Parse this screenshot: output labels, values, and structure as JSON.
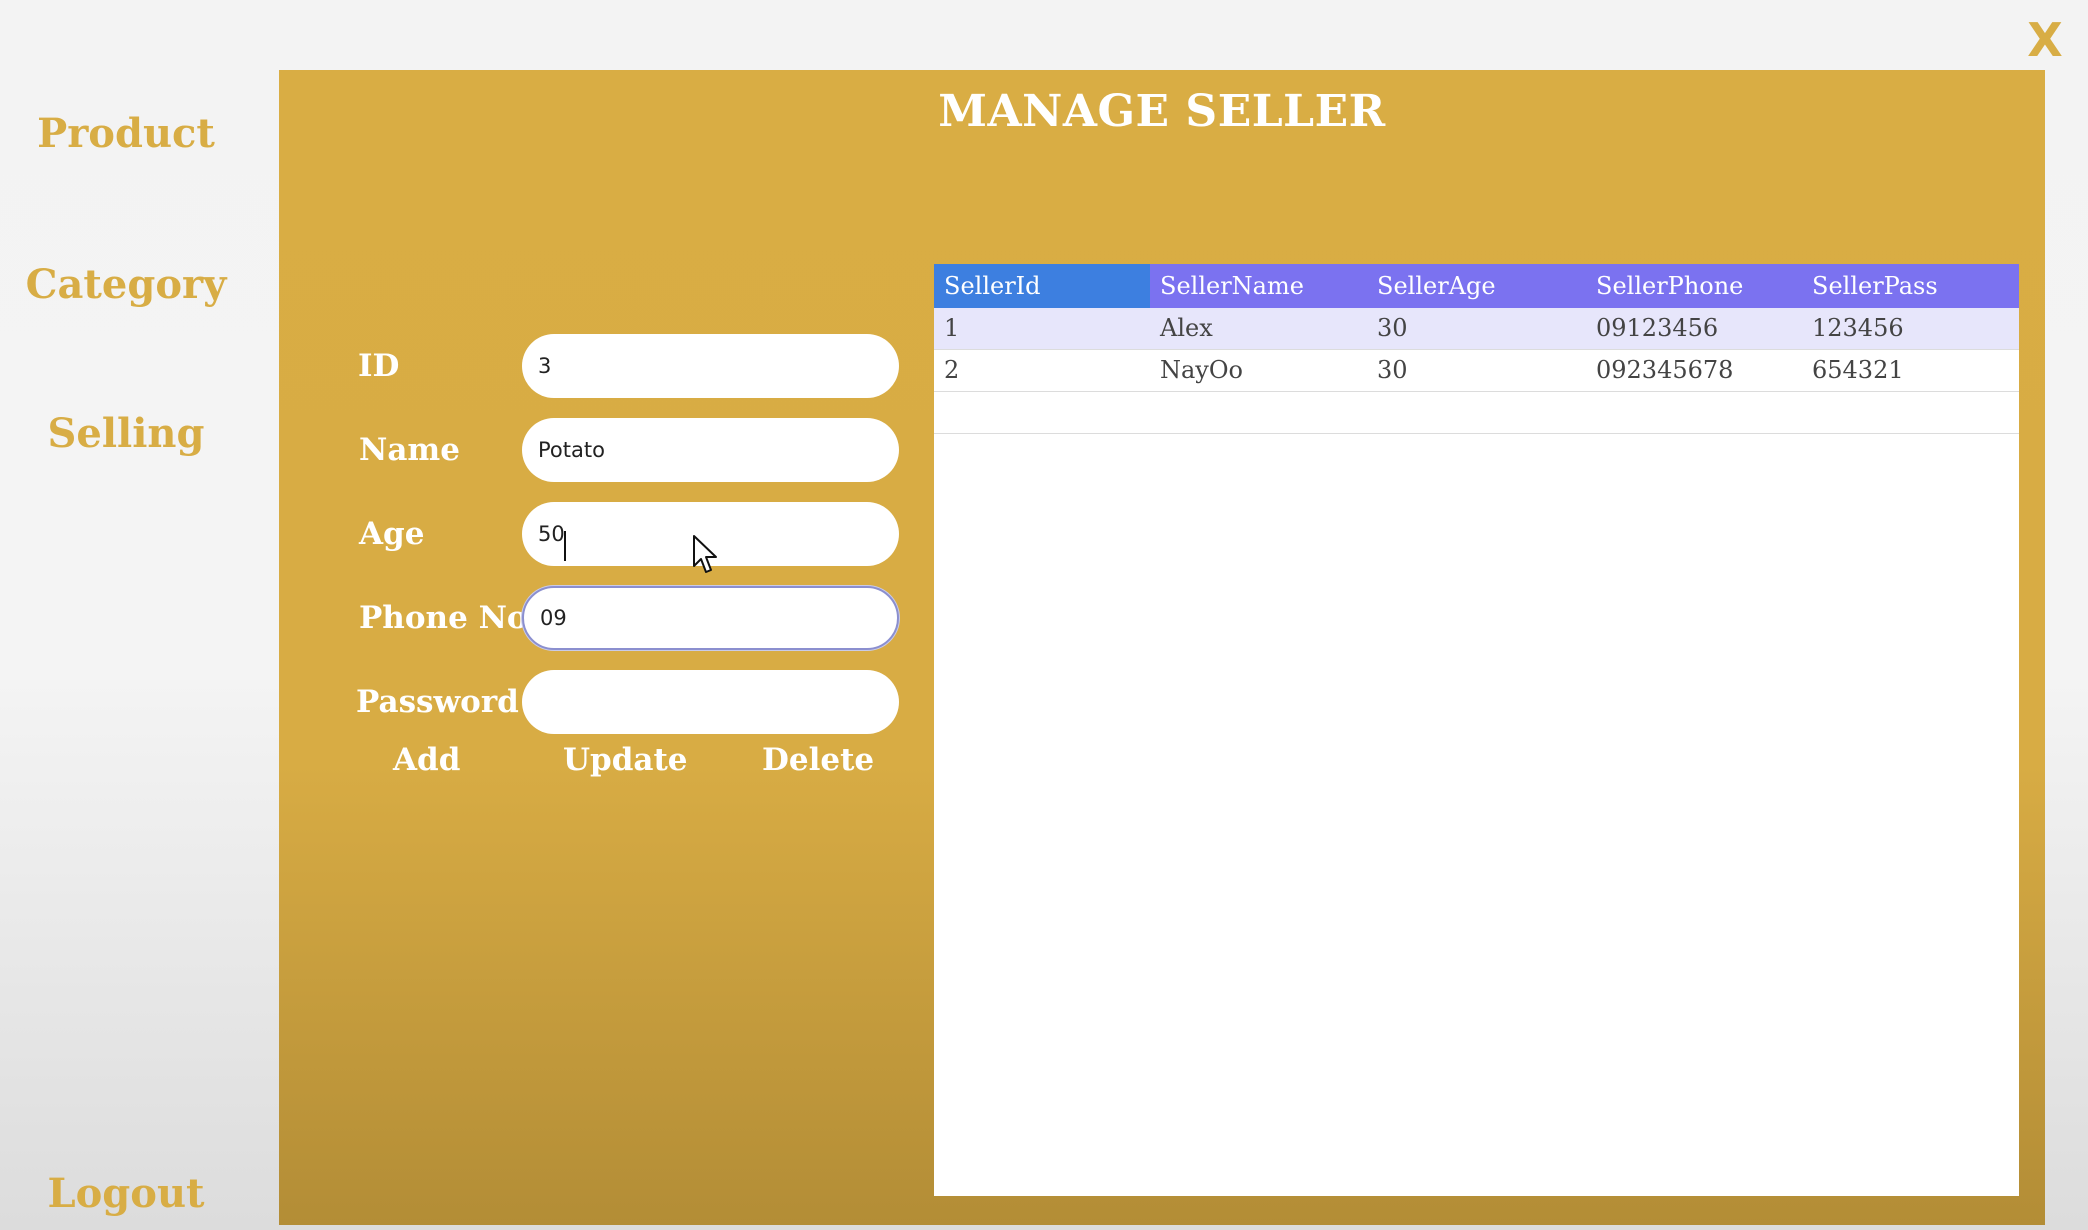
{
  "sidebar": {
    "items": [
      {
        "label": "Product"
      },
      {
        "label": "Category"
      },
      {
        "label": "Selling"
      }
    ],
    "logout": "Logout"
  },
  "window": {
    "close_label": "X"
  },
  "main": {
    "title": "MANAGE SELLER",
    "fields": {
      "id": {
        "label": "ID",
        "value": "3"
      },
      "name": {
        "label": "Name",
        "value": "Potato"
      },
      "age": {
        "label": "Age",
        "value": "50"
      },
      "phone": {
        "label": "Phone No",
        "value": "09"
      },
      "password": {
        "label": "Password",
        "value": ""
      }
    },
    "buttons": {
      "add": "Add",
      "update": "Update",
      "delete": "Delete"
    },
    "table": {
      "columns": [
        "SellerId",
        "SellerName",
        "SellerAge",
        "SellerPhone",
        "SellerPass"
      ],
      "rows": [
        [
          "1",
          "Alex",
          "30",
          "09123456",
          "123456"
        ],
        [
          "2",
          "NayOo",
          "30",
          "092345678",
          "654321"
        ]
      ]
    }
  },
  "colors": {
    "accent": "#d8ad45",
    "panel": "#d9ad44",
    "table_header": "#7b72f0",
    "table_header_selected": "#3d7fe0",
    "row_highlight": "#e7e6fb"
  }
}
